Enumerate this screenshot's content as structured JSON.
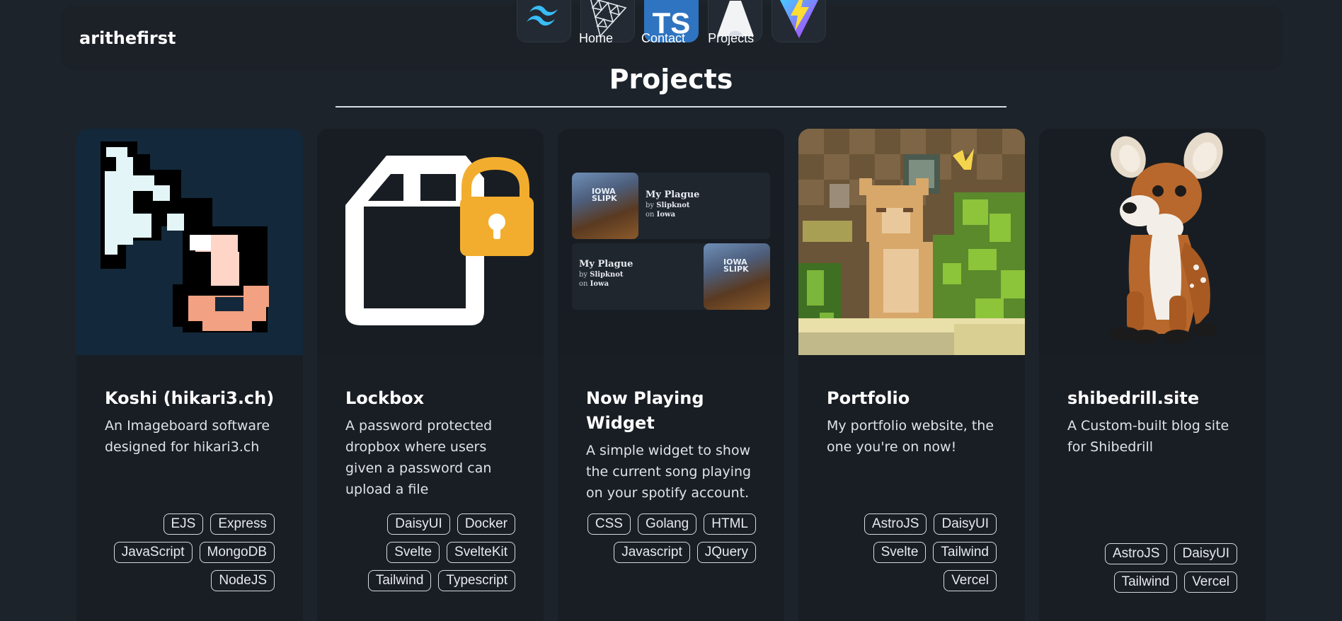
{
  "header": {
    "brand": "arithefirst",
    "nav": [
      {
        "label": "Home"
      },
      {
        "label": "Contact"
      },
      {
        "label": "Projects"
      }
    ],
    "tech_icons": [
      "tailwind-icon",
      "threejs-icon",
      "typescript-icon",
      "astro-icon",
      "vite-icon"
    ],
    "ts_label": "TS"
  },
  "page": {
    "title": "Projects"
  },
  "projects": [
    {
      "title": "Koshi (hikari3.ch)",
      "description": "An Imageboard software designed for hikari3.ch",
      "tags": [
        "EJS",
        "Express",
        "JavaScript",
        "MongoDB",
        "NodeJS"
      ],
      "image": "koshi-pixel-logo"
    },
    {
      "title": "Lockbox",
      "description": "A password protected dropbox where users given a password can upload a file",
      "tags": [
        "DaisyUI",
        "Docker",
        "Svelte",
        "SvelteKit",
        "Tailwind",
        "Typescript"
      ],
      "image": "lockbox-logo"
    },
    {
      "title": "Now Playing Widget",
      "description": "A simple widget to show the current song playing on your spotify account.",
      "tags": [
        "CSS",
        "Golang",
        "HTML",
        "Javascript",
        "JQuery"
      ],
      "image": "now-playing-preview",
      "preview": {
        "song": "My Plague",
        "by_label": "by",
        "artist": "Slipknot",
        "on_label": "on",
        "album": "Iowa",
        "art_text": "IOWA SLIPK"
      }
    },
    {
      "title": "Portfolio",
      "description": "My portfolio website, the one you're on now!",
      "tags": [
        "AstroJS",
        "DaisyUI",
        "Svelte",
        "Tailwind",
        "Vercel"
      ],
      "image": "pixel-cat-scene"
    },
    {
      "title": "shibedrill.site",
      "description": "A Custom-built blog site for Shibedrill",
      "tags": [
        "AstroJS",
        "DaisyUI",
        "Tailwind",
        "Vercel"
      ],
      "image": "plush-deer-photo"
    }
  ],
  "colors": {
    "background": "#1d232a",
    "card": "#191e24",
    "lock_orange": "#f3ad2e",
    "ts_blue": "#2f74c0"
  }
}
